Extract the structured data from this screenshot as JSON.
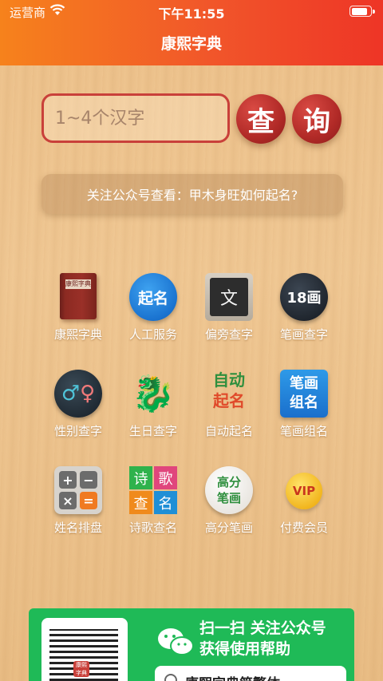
{
  "status_bar": {
    "carrier": "运营商",
    "time": "下午11:55",
    "battery_level": 0.9
  },
  "nav": {
    "title": "康熙字典"
  },
  "search": {
    "placeholder": "1~4个汉字",
    "btn_cha": "查",
    "btn_xun": "询"
  },
  "notice": {
    "text": "关注公众号查看：甲木身旺如何起名?"
  },
  "grid": {
    "items": [
      {
        "label": "康熙字典",
        "icon": "book-icon"
      },
      {
        "label": "人工服务",
        "icon": "qiming-badge-icon",
        "glyph": "起名"
      },
      {
        "label": "偏旁查字",
        "icon": "blackboard-icon",
        "glyph": "文"
      },
      {
        "label": "笔画查字",
        "icon": "stroke-18-icon",
        "glyph": "18画"
      },
      {
        "label": "性别查字",
        "icon": "gender-icon",
        "glyph_m": "♂",
        "glyph_f": "♀"
      },
      {
        "label": "生日查字",
        "icon": "dragon-icon",
        "glyph": "🐉"
      },
      {
        "label": "自动起名",
        "icon": "auto-naming-icon",
        "glyph_top": "自动",
        "glyph_bottom": "起名"
      },
      {
        "label": "笔画组名",
        "icon": "stroke-combo-icon",
        "glyph_top": "笔画",
        "glyph_bottom": "组名"
      },
      {
        "label": "姓名排盘",
        "icon": "calculator-icon",
        "keys": [
          "+",
          "−",
          "×",
          "="
        ]
      },
      {
        "label": "诗歌查名",
        "icon": "poem-tiles-icon",
        "tiles": [
          "诗",
          "歌",
          "查",
          "名"
        ]
      },
      {
        "label": "高分笔画",
        "icon": "high-score-icon",
        "glyph_top": "高分",
        "glyph_bottom": "笔画"
      },
      {
        "label": "付费会员",
        "icon": "vip-icon",
        "glyph": "VIP"
      }
    ]
  },
  "footer": {
    "line1": "扫一扫 关注公众号",
    "line2": "获得使用帮助",
    "search_text": "康熙字典简繁体",
    "qr_mark": "康熙字典"
  },
  "colors": {
    "header_left": "#f6821c",
    "header_right": "#ee3526",
    "accent_red": "#c9403a",
    "footer_green": "#1fba57"
  }
}
